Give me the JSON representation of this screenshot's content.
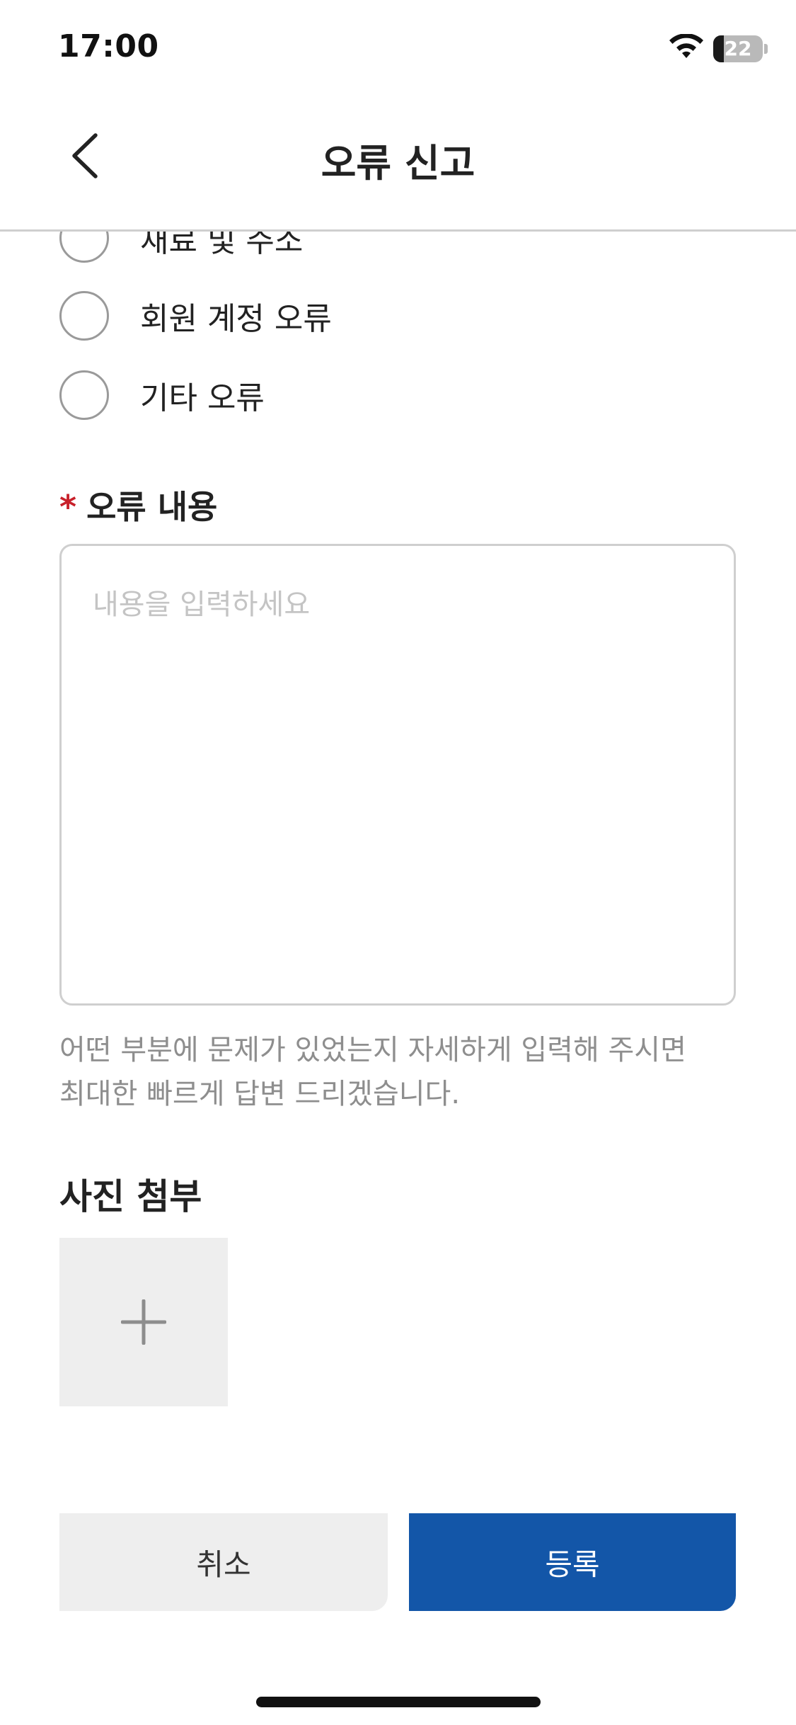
{
  "status_bar": {
    "time": "17:00",
    "battery_level": "22",
    "battery_fraction": 0.22,
    "wifi_icon": "wifi-icon"
  },
  "nav": {
    "title": "오류 신고",
    "back_icon": "chevron-left-icon"
  },
  "error_types": [
    {
      "label": "재료 및 주소",
      "selected": false
    },
    {
      "label": "회원 계정 오류",
      "selected": false
    },
    {
      "label": "기타 오류",
      "selected": false
    }
  ],
  "content": {
    "required_mark": "*",
    "label": "오류 내용",
    "value": "",
    "placeholder": "내용을 입력하세요",
    "helper_line1": "어떤 부분에 문제가 있었는지 자세하게 입력해 주시면",
    "helper_line2": "최대한 빠르게 답변 드리겠습니다."
  },
  "photo": {
    "title": "사진 첨부",
    "add_icon": "plus-icon"
  },
  "buttons": {
    "cancel": "취소",
    "submit": "등록"
  },
  "colors": {
    "primary": "#1356a8",
    "required": "#c8202a",
    "muted_text": "#8e8e8e",
    "placeholder": "#c4c4c4",
    "light_bg": "#eeeeee"
  }
}
